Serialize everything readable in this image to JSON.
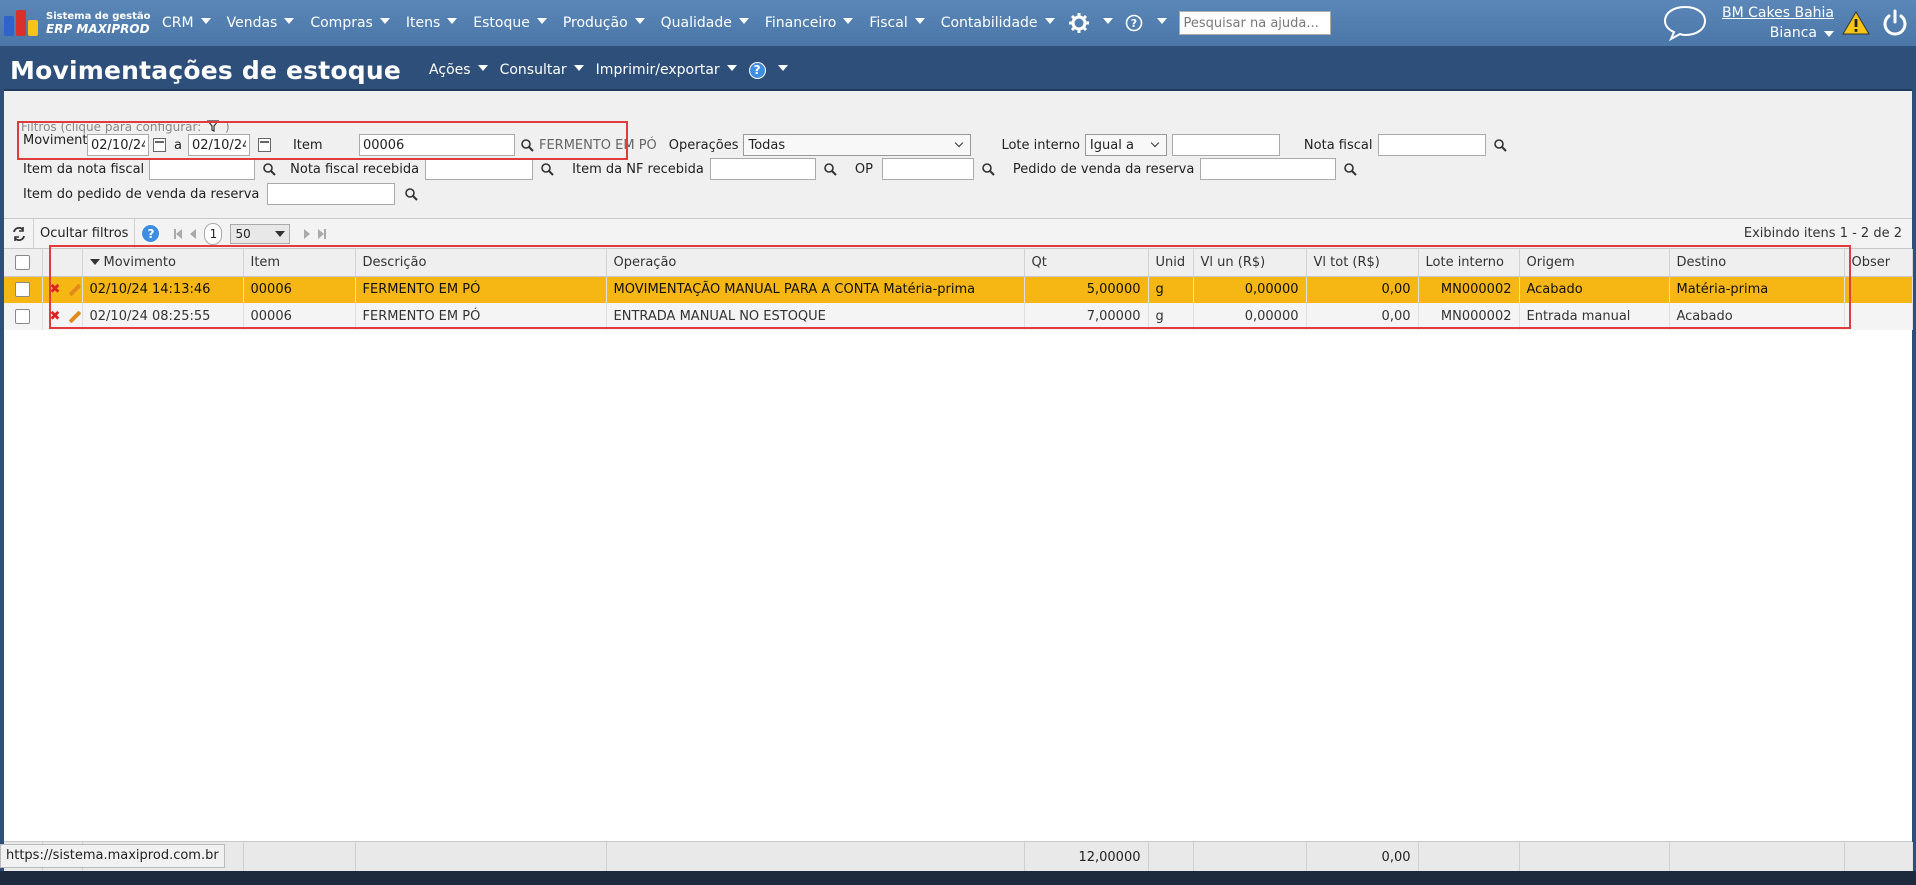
{
  "brand": {
    "line1": "Sistema de gestão",
    "line2": "ERP MAXIPROD"
  },
  "nav": {
    "items": [
      "CRM",
      "Vendas",
      "Compras",
      "Itens",
      "Estoque",
      "Produção",
      "Qualidade",
      "Financeiro",
      "Fiscal",
      "Contabilidade"
    ],
    "help_search_placeholder": "Pesquisar na ajuda...",
    "company": "BM Cakes Bahia",
    "user": "Bianca"
  },
  "page": {
    "title": "Movimentações de estoque",
    "menus": [
      "Ações",
      "Consultar",
      "Imprimir/exportar"
    ]
  },
  "filters": {
    "caption": "Filtros (clique para configurar:",
    "caption_end": ")",
    "movimento_label": "Movimento",
    "date_from": "02/10/24",
    "date_sep": "a",
    "date_to": "02/10/24",
    "item_label": "Item",
    "item_value": "00006",
    "item_desc": "FERMENTO EM PÓ",
    "operacoes_label": "Operações",
    "operacoes_value": "Todas",
    "lote_label": "Lote interno",
    "lote_op": "Igual a",
    "lote_value": "",
    "nf_label": "Nota fiscal",
    "nf_value": "",
    "item_nf_label": "Item da nota fiscal",
    "nf_recebida_label": "Nota fiscal recebida",
    "item_nf_recebida_label": "Item da NF recebida",
    "op_label": "OP",
    "pedido_label": "Pedido de venda da reserva",
    "item_pedido_label": "Item do pedido de venda da reserva"
  },
  "gridbar": {
    "hide_filters": "Ocultar filtros",
    "page": "1",
    "page_size": "50",
    "showing": "Exibindo itens 1 - 2 de 2"
  },
  "columns": [
    "Movimento",
    "Item",
    "Descrição",
    "Operação",
    "Qt",
    "Unid",
    "Vl un (R$)",
    "Vl tot (R$)",
    "Lote interno",
    "Origem",
    "Destino",
    "Obser"
  ],
  "rows": [
    {
      "movimento": "02/10/24 14:13:46",
      "item": "00006",
      "descricao": "FERMENTO EM PÓ",
      "operacao": "MOVIMENTAÇÃO MANUAL PARA A CONTA Matéria-prima",
      "qt": "5,00000",
      "unid": "g",
      "vl_un": "0,00000",
      "vl_tot": "0,00",
      "lote": "MN000002",
      "origem": "Acabado",
      "destino": "Matéria-prima"
    },
    {
      "movimento": "02/10/24 08:25:55",
      "item": "00006",
      "descricao": "FERMENTO EM PÓ",
      "operacao": "ENTRADA MANUAL NO ESTOQUE",
      "qt": "7,00000",
      "unid": "g",
      "vl_un": "0,00000",
      "vl_tot": "0,00",
      "lote": "MN000002",
      "origem": "Entrada manual",
      "destino": "Acabado"
    }
  ],
  "totals": {
    "qt": "12,00000",
    "vl_tot": "0,00"
  },
  "status_url": "https://sistema.maxiprod.com.br"
}
